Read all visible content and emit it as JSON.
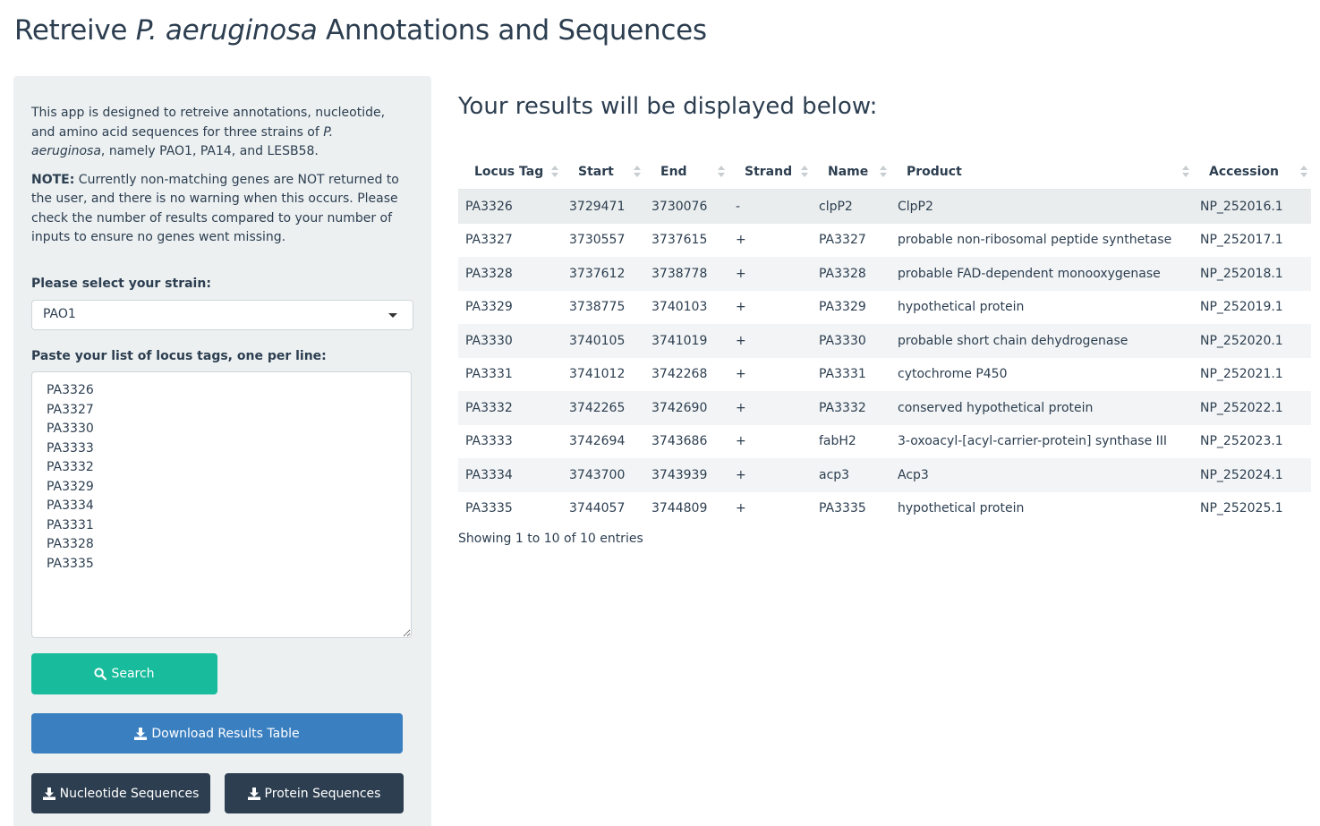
{
  "title": {
    "prefix": "Retreive ",
    "species": "P. aeruginosa",
    "suffix": " Annotations and Sequences"
  },
  "sidebar": {
    "intro_part1": "This app is designed to retreive annotations, nucleotide, and amino acid sequences for three strains of ",
    "intro_species": "P. aeruginosa",
    "intro_part2": ", namely PAO1, PA14, and LESB58.",
    "note_label": "NOTE:",
    "note_text": " Currently non-matching genes are NOT returned to the user, and there is no warning when this occurs. Please check the number of results compared to your number of inputs to ensure no genes went missing.",
    "strain_label": "Please select your strain:",
    "strain_value": "PAO1",
    "locus_label": "Paste your list of locus tags, one per line:",
    "locus_text": "PA3326\nPA3327\nPA3330\nPA3333\nPA3332\nPA3329\nPA3334\nPA3331\nPA3328\nPA3335",
    "search_label": "Search",
    "download_table_label": "Download Results Table",
    "nucleotide_label": "Nucleotide Sequences",
    "protein_label": "Protein Sequences",
    "search_icon": "search-icon",
    "download_icon": "download-icon",
    "colors": {
      "panel_bg": "#ecf0f1",
      "search_btn": "#18bc9c",
      "download_btn": "#3a7fc0",
      "dark_btn": "#2c3e50"
    }
  },
  "main": {
    "heading": "Your results will be displayed below:",
    "columns": [
      "Locus Tag",
      "Start",
      "End",
      "Strand",
      "Name",
      "Product",
      "Accession"
    ],
    "rows": [
      [
        "PA3326",
        "3729471",
        "3730076",
        "-",
        "clpP2",
        "ClpP2",
        "NP_252016.1"
      ],
      [
        "PA3327",
        "3730557",
        "3737615",
        "+",
        "PA3327",
        "probable non-ribosomal peptide synthetase",
        "NP_252017.1"
      ],
      [
        "PA3328",
        "3737612",
        "3738778",
        "+",
        "PA3328",
        "probable FAD-dependent monooxygenase",
        "NP_252018.1"
      ],
      [
        "PA3329",
        "3738775",
        "3740103",
        "+",
        "PA3329",
        "hypothetical protein",
        "NP_252019.1"
      ],
      [
        "PA3330",
        "3740105",
        "3741019",
        "+",
        "PA3330",
        "probable short chain dehydrogenase",
        "NP_252020.1"
      ],
      [
        "PA3331",
        "3741012",
        "3742268",
        "+",
        "PA3331",
        "cytochrome P450",
        "NP_252021.1"
      ],
      [
        "PA3332",
        "3742265",
        "3742690",
        "+",
        "PA3332",
        "conserved hypothetical protein",
        "NP_252022.1"
      ],
      [
        "PA3333",
        "3742694",
        "3743686",
        "+",
        "fabH2",
        "3-oxoacyl-[acyl-carrier-protein] synthase III",
        "NP_252023.1"
      ],
      [
        "PA3334",
        "3743700",
        "3743939",
        "+",
        "acp3",
        "Acp3",
        "NP_252024.1"
      ],
      [
        "PA3335",
        "3744057",
        "3744809",
        "+",
        "PA3335",
        "hypothetical protein",
        "NP_252025.1"
      ]
    ],
    "info": "Showing 1 to 10 of 10 entries"
  }
}
